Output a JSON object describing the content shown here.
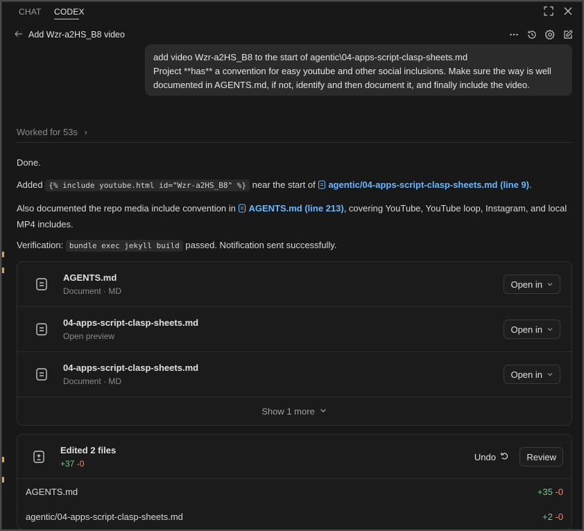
{
  "tabs": [
    {
      "label": "CHAT",
      "active": false
    },
    {
      "label": "CODEX",
      "active": true
    }
  ],
  "header": {
    "back_icon": "arrow-left-icon",
    "title": "Add Wzr-a2HS_B8 video"
  },
  "user_message": {
    "lines": [
      "add video Wzr-a2HS_B8 to the start of agentic\\04-apps-script-clasp-sheets.md",
      "Project **has** a convention for easy youtube and other social inclusions. Make sure the way is well",
      "documented in AGENTS.md, if not, identify and then  document it, and finally include the video."
    ]
  },
  "worked_for": "Worked for 53s",
  "response": {
    "done": "Done.",
    "added_prefix": "Added",
    "added_code": "{% include youtube.html id=\"Wzr-a2HS_B8\" %}",
    "added_mid": "near the start of",
    "added_link": "agentic/04-apps-script-clasp-sheets.md (line 9)",
    "added_suffix": ".",
    "doc_prefix": "Also documented the repo media include convention in",
    "doc_link": "AGENTS.md (line 213)",
    "doc_suffix_1": ", covering YouTube, YouTube loop, Instagram, and local",
    "doc_suffix_2": "MP4 includes.",
    "verif_prefix": "Verification:",
    "verif_code": "bundle exec jekyll build",
    "verif_suffix": "passed. Notification sent successfully."
  },
  "files_card": {
    "items": [
      {
        "name": "AGENTS.md",
        "sub": "Document · MD",
        "button": "Open in"
      },
      {
        "name": "04-apps-script-clasp-sheets.md",
        "sub": "Open preview",
        "button": "Open in"
      },
      {
        "name": "04-apps-script-clasp-sheets.md",
        "sub": "Document · MD",
        "button": "Open in"
      }
    ],
    "show_more": "Show 1 more"
  },
  "edited": {
    "title": "Edited 2 files",
    "added": "+37",
    "removed": "-0",
    "undo": "Undo",
    "review": "Review",
    "files": [
      {
        "name": "AGENTS.md",
        "added": "+35",
        "removed": "-0"
      },
      {
        "name": "agentic/04-apps-script-clasp-sheets.md",
        "added": "+2",
        "removed": "-0"
      }
    ]
  },
  "colors": {
    "accent_link": "#6cb6ff",
    "added": "#73c991",
    "removed": "#f48771",
    "marker": "#e5a445"
  }
}
